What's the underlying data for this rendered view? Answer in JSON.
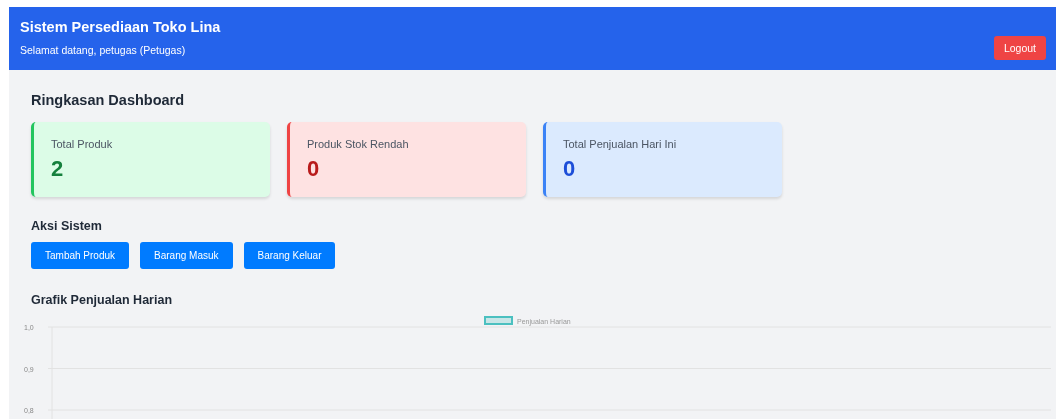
{
  "header": {
    "title": "Sistem Persediaan Toko Lina",
    "subtitle": "Selamat datang, petugas (Petugas)",
    "logout": "Logout"
  },
  "summary": {
    "title": "Ringkasan Dashboard",
    "cards": [
      {
        "label": "Total Produk",
        "value": "2",
        "kind": "success"
      },
      {
        "label": "Produk Stok Rendah",
        "value": "0",
        "kind": "danger"
      },
      {
        "label": "Total Penjualan Hari Ini",
        "value": "0",
        "kind": "info"
      }
    ]
  },
  "actions": {
    "title": "Aksi Sistem",
    "buttons": [
      "Tambah Produk",
      "Barang Masuk",
      "Barang Keluar"
    ]
  },
  "chart": {
    "title": "Grafik Penjualan Harian",
    "chart_data": {
      "type": "line",
      "series": [
        {
          "name": "Penjualan Harian",
          "color": "#4bc0c0"
        }
      ],
      "ylim": [
        0.8,
        1.0
      ],
      "yticks": [
        {
          "value": 1.0,
          "label": "1,0"
        },
        {
          "value": 0.9,
          "label": "0,9"
        },
        {
          "value": 0.8,
          "label": "0,8"
        }
      ]
    }
  }
}
